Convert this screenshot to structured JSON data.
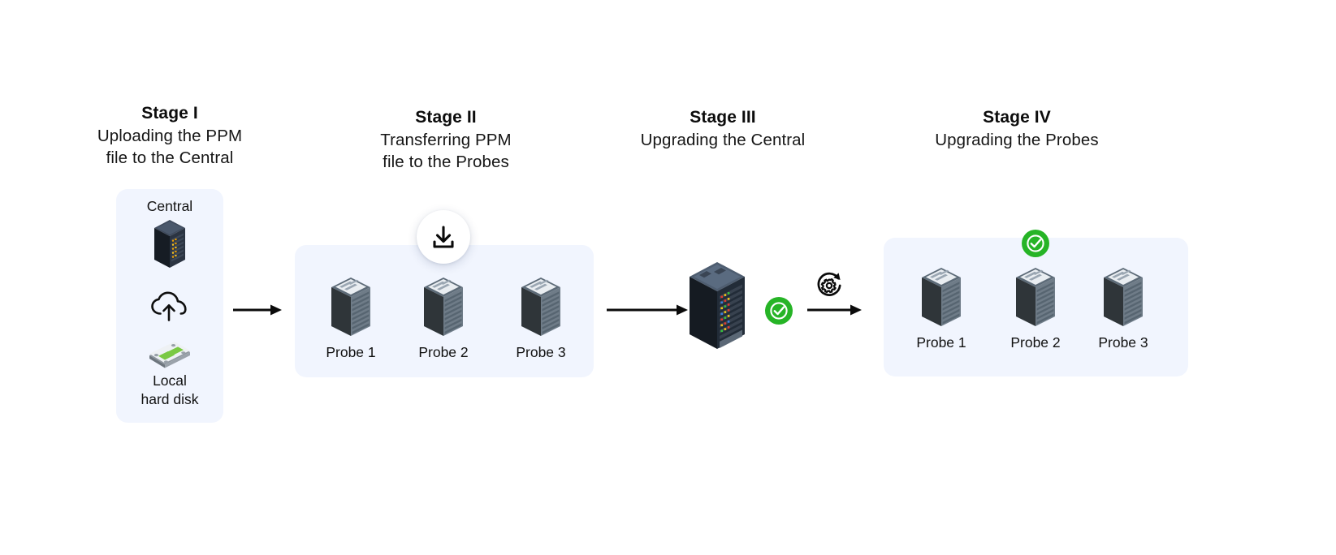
{
  "diagram": {
    "background_color": "#ffffff",
    "panel_color": "#f1f5fe",
    "accent_green": "#26b426",
    "ink": "#111111"
  },
  "stages": [
    {
      "id": "stage-1",
      "title": "Stage I",
      "subtitle_line_1": "Uploading the PPM",
      "subtitle_line_2": "file to the Central"
    },
    {
      "id": "stage-2",
      "title": "Stage II",
      "subtitle_line_1": "Transferring PPM",
      "subtitle_line_2": "file to the Probes"
    },
    {
      "id": "stage-3",
      "title": "Stage III",
      "subtitle_line_1": "Upgrading the Central",
      "subtitle_line_2": ""
    },
    {
      "id": "stage-4",
      "title": "Stage IV",
      "subtitle_line_1": "Upgrading the Probes",
      "subtitle_line_2": ""
    }
  ],
  "stage1": {
    "central_label": "Central",
    "local_disk_label_line_1": "Local",
    "local_disk_label_line_2": "hard disk",
    "icons": {
      "server": "central-server-icon",
      "cloud": "cloud-upload-icon",
      "disk": "hard-disk-icon"
    }
  },
  "stage2": {
    "badge_icon": "download-icon",
    "probes": [
      {
        "label": "Probe 1"
      },
      {
        "label": "Probe 2"
      },
      {
        "label": "Probe 3"
      }
    ]
  },
  "stage3": {
    "server_icon": "central-server-icon",
    "status_icon": "check-circle-icon",
    "transition_icon": "upgrade-refresh-gear-icon"
  },
  "stage4": {
    "status_icon": "check-circle-icon",
    "probes": [
      {
        "label": "Probe 1"
      },
      {
        "label": "Probe 2"
      },
      {
        "label": "Probe 3"
      }
    ]
  },
  "arrows": [
    {
      "name": "arrow-stage1-to-stage2"
    },
    {
      "name": "arrow-stage2-to-stage3"
    },
    {
      "name": "arrow-stage3-to-stage4"
    }
  ]
}
